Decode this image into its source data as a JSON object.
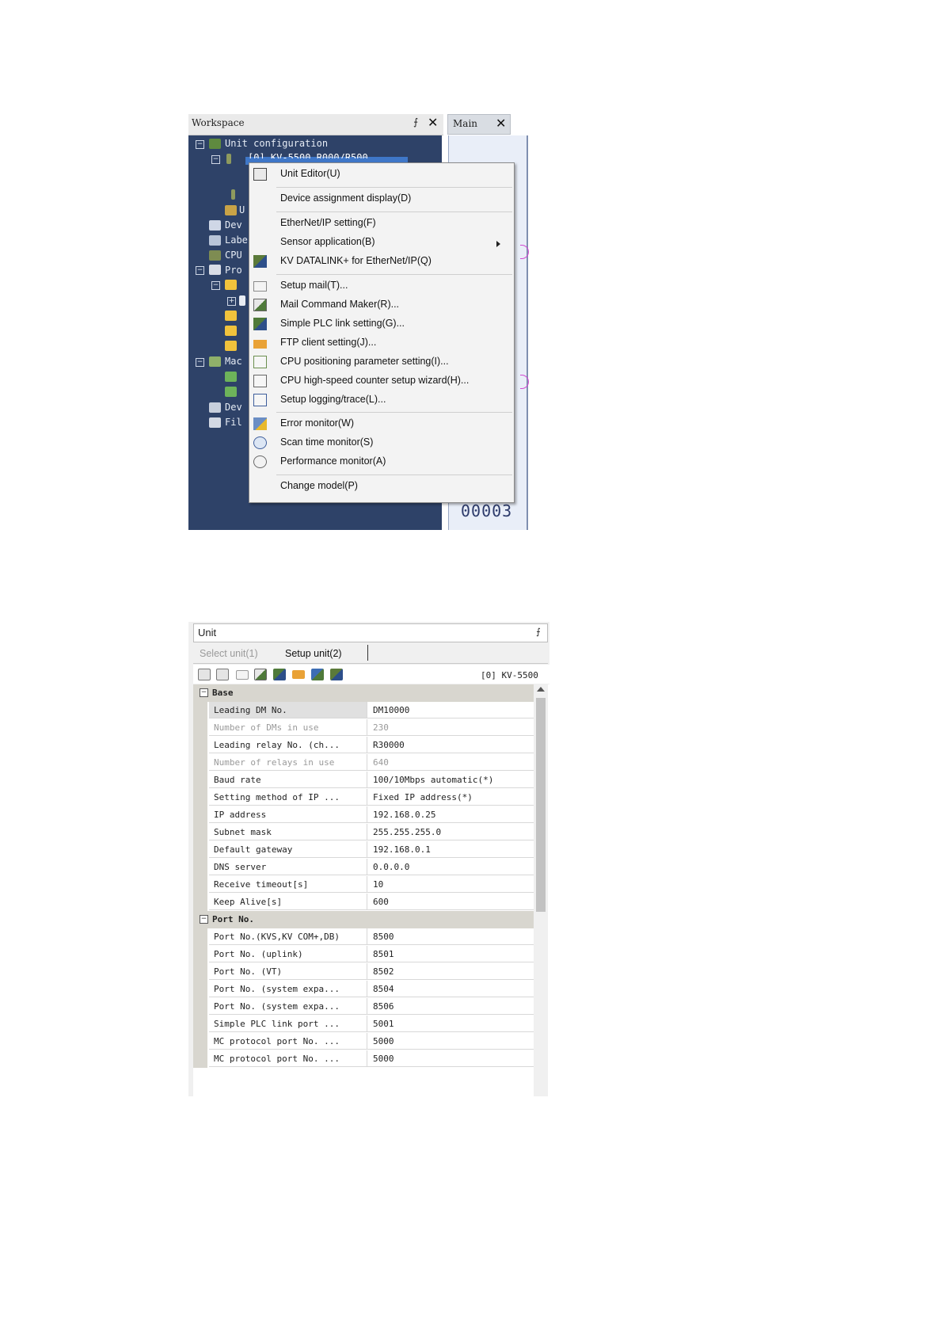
{
  "workspace": {
    "title": "Workspace",
    "main_tab": "Main",
    "main_number": "00003",
    "tree": [
      {
        "label": "Unit configuration"
      },
      {
        "label": "[0]  KV-5500       R000/R500"
      },
      {
        "label": "U"
      },
      {
        "label": "Dev"
      },
      {
        "label": "Labe"
      },
      {
        "label": "CPU"
      },
      {
        "label": "Pro"
      },
      {
        "label": "Mac"
      },
      {
        "label": "Dev"
      },
      {
        "label": "Fil"
      }
    ]
  },
  "context_menu": {
    "items": [
      {
        "label": "Unit Editor(U)",
        "icon": "unit-editor-icon"
      },
      {
        "label": "Device assignment display(D)",
        "icon": ""
      },
      {
        "label": "EtherNet/IP setting(F)",
        "icon": ""
      },
      {
        "label": "Sensor application(B)",
        "icon": ""
      },
      {
        "label": "KV DATALINK+ for EtherNet/IP(Q)",
        "icon": "datalink-icon"
      },
      {
        "label": "Setup mail(T)...",
        "icon": "mail-icon"
      },
      {
        "label": "Mail Command Maker(R)...",
        "icon": "mail-command-icon"
      },
      {
        "label": "Simple PLC link setting(G)...",
        "icon": "plc-link-icon"
      },
      {
        "label": "FTP client setting(J)...",
        "icon": "ftp-icon"
      },
      {
        "label": "CPU positioning parameter setting(I)...",
        "icon": "positioning-icon"
      },
      {
        "label": "CPU high-speed counter setup wizard(H)...",
        "icon": "counter-icon"
      },
      {
        "label": "Setup logging/trace(L)...",
        "icon": "logging-icon"
      },
      {
        "label": "Error monitor(W)",
        "icon": "error-monitor-icon"
      },
      {
        "label": "Scan time monitor(S)",
        "icon": "scan-time-icon"
      },
      {
        "label": "Performance monitor(A)",
        "icon": "performance-icon"
      },
      {
        "label": "Change model(P)",
        "icon": ""
      }
    ]
  },
  "unit_panel": {
    "title": "Unit",
    "tabs": [
      "Select unit(1)",
      "Setup unit(2)"
    ],
    "model": "[0] KV-5500",
    "groups": [
      {
        "label": "Base"
      },
      {
        "label": "Port No."
      }
    ],
    "base_rows": [
      {
        "name": "Leading DM No.",
        "value": "DM10000"
      },
      {
        "name": "Number of DMs in use",
        "value": "230"
      },
      {
        "name": "Leading relay No. (ch...",
        "value": "R30000"
      },
      {
        "name": "Number of relays in use",
        "value": "640"
      },
      {
        "name": "Baud rate",
        "value": "100/10Mbps automatic(*)"
      },
      {
        "name": "Setting method of IP ...",
        "value": "Fixed IP address(*)"
      },
      {
        "name": "IP address",
        "value": "192.168.0.25"
      },
      {
        "name": "Subnet mask",
        "value": "255.255.255.0"
      },
      {
        "name": "Default gateway",
        "value": "192.168.0.1"
      },
      {
        "name": "DNS server",
        "value": "0.0.0.0"
      },
      {
        "name": "Receive timeout[s]",
        "value": "10"
      },
      {
        "name": "Keep Alive[s]",
        "value": "600"
      }
    ],
    "port_rows": [
      {
        "name": "Port No.(KVS,KV COM+,DB)",
        "value": "8500"
      },
      {
        "name": "Port No. (uplink)",
        "value": "8501"
      },
      {
        "name": "Port No. (VT)",
        "value": "8502"
      },
      {
        "name": "Port No. (system expa...",
        "value": "8504"
      },
      {
        "name": "Port No. (system expa...",
        "value": "8506"
      },
      {
        "name": "Simple PLC link port ...",
        "value": "5001"
      },
      {
        "name": "MC protocol port No. ...",
        "value": "5000"
      },
      {
        "name": "MC protocol port No. ...",
        "value": "5000"
      }
    ]
  }
}
